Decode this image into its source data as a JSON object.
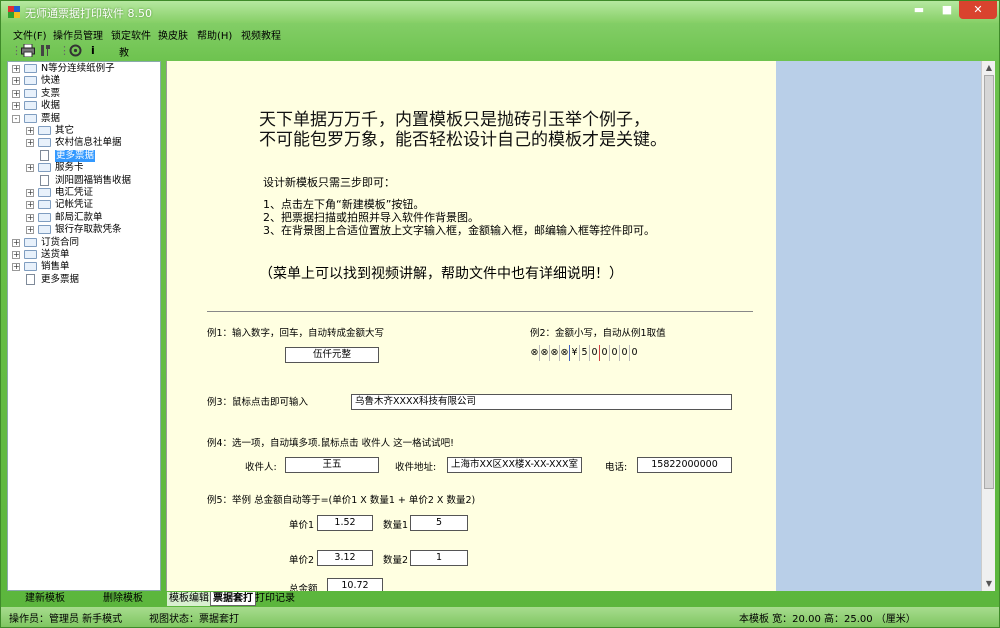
{
  "window": {
    "title": "无师通票据打印软件 8.50",
    "min": "▬",
    "max": "■",
    "close": "✕"
  },
  "menu": [
    "文件(F)",
    "操作员管理",
    "锁定软件",
    "换皮肤",
    "帮助(H)",
    "视频教程"
  ],
  "toolbar": {
    "print_icon": "printer-icon",
    "tools_icon": "tools-icon",
    "settings_icon": "gear-icon",
    "info": "i",
    "teach": "教"
  },
  "tree": {
    "items": [
      {
        "label": "N等分连续纸例子",
        "level": 0,
        "type": "folder",
        "exp": "+"
      },
      {
        "label": "快递",
        "level": 0,
        "type": "folder",
        "exp": "+"
      },
      {
        "label": "支票",
        "level": 0,
        "type": "folder",
        "exp": "+"
      },
      {
        "label": "收据",
        "level": 0,
        "type": "folder",
        "exp": "+"
      },
      {
        "label": "票据",
        "level": 0,
        "type": "folder",
        "exp": "-"
      },
      {
        "label": "其它",
        "level": 1,
        "type": "folder",
        "exp": "+"
      },
      {
        "label": "农村信息社单据",
        "level": 1,
        "type": "folder",
        "exp": "+"
      },
      {
        "label": "更多票据",
        "level": 1,
        "type": "doc",
        "exp": "",
        "selected": true
      },
      {
        "label": "服务卡",
        "level": 1,
        "type": "folder",
        "exp": "+"
      },
      {
        "label": "浏阳圆福销售收据",
        "level": 1,
        "type": "doc",
        "exp": ""
      },
      {
        "label": "电汇凭证",
        "level": 1,
        "type": "folder",
        "exp": "+"
      },
      {
        "label": "记帐凭证",
        "level": 1,
        "type": "folder",
        "exp": "+"
      },
      {
        "label": "邮局汇款单",
        "level": 1,
        "type": "folder",
        "exp": "+"
      },
      {
        "label": "银行存取款凭条",
        "level": 1,
        "type": "folder",
        "exp": "+"
      },
      {
        "label": "订货合同",
        "level": 0,
        "type": "folder",
        "exp": "+"
      },
      {
        "label": "送货单",
        "level": 0,
        "type": "folder",
        "exp": "+"
      },
      {
        "label": "销售单",
        "level": 0,
        "type": "folder",
        "exp": "+"
      },
      {
        "label": "更多票据",
        "level": 0,
        "type": "doc",
        "exp": ""
      }
    ]
  },
  "canvas": {
    "heading1": "天下单据万万千，内置模板只是抛砖引玉举个例子，",
    "heading2": "不可能包罗万象，能否轻松设计自己的模板才是关键。",
    "steps_title": "设计新模板只需三步即可：",
    "step1": "1、点击左下角“新建模板”按钮。",
    "step2": "2、把票据扫描或拍照并导入软件作背景图。",
    "step3": "3、在背景图上合适位置放上文字输入框，金额输入框，邮编输入框等控件即可。",
    "note": "（菜单上可以找到视频讲解，帮助文件中也有详细说明！）",
    "ex1_label": "例1：输入数字，回车，自动转成金额大写",
    "ex1_value": "伍仟元整",
    "ex2_label": "例2：金额小写，自动从例1取值",
    "ex2_digits": [
      "⊗",
      "⊗",
      "⊗",
      "⊗",
      "¥",
      "5",
      "0",
      "0",
      "0",
      "0",
      "0"
    ],
    "ex3_label": "例3：鼠标点击即可输入",
    "ex3_value": "乌鲁木齐XXXX科技有限公司",
    "ex4_label": "例4：选一项，自动填多项.鼠标点击 收件人 这一格试试吧!",
    "recipient_label": "收件人:",
    "recipient_value": "王五",
    "address_label": "收件地址:",
    "address_value": "上海市XX区XX楼X-XX-XXX室",
    "phone_label": "电话:",
    "phone_value": "15822000000",
    "ex5_label": "例5：举例 总金额自动等于=(单价1 X 数量1 + 单价2 X 数量2)",
    "price1_label": "单价1",
    "price1_value": "1.52",
    "qty1_label": "数量1",
    "qty1_value": "5",
    "price2_label": "单价2",
    "price2_value": "3.12",
    "qty2_label": "数量2",
    "qty2_value": "1",
    "total_label": "总金额",
    "total_value": "10.72"
  },
  "bottom_tabs": {
    "new_template": "建新模板",
    "delete_template": "删除模板",
    "edit": "模板编辑",
    "print_set": "票据套打",
    "print_log": "打印记录"
  },
  "status": {
    "operator": "操作员：管理员  新手模式",
    "view_state": "视图状态：票据套打",
    "template_size": "本模板  宽：20.00  高：25.00 （厘米）"
  },
  "colors": {
    "skin_green": "#6cc24d",
    "canvas_bg": "#ffffe1",
    "right_panel": "#b9cfe8",
    "close_red": "#d9432e"
  }
}
